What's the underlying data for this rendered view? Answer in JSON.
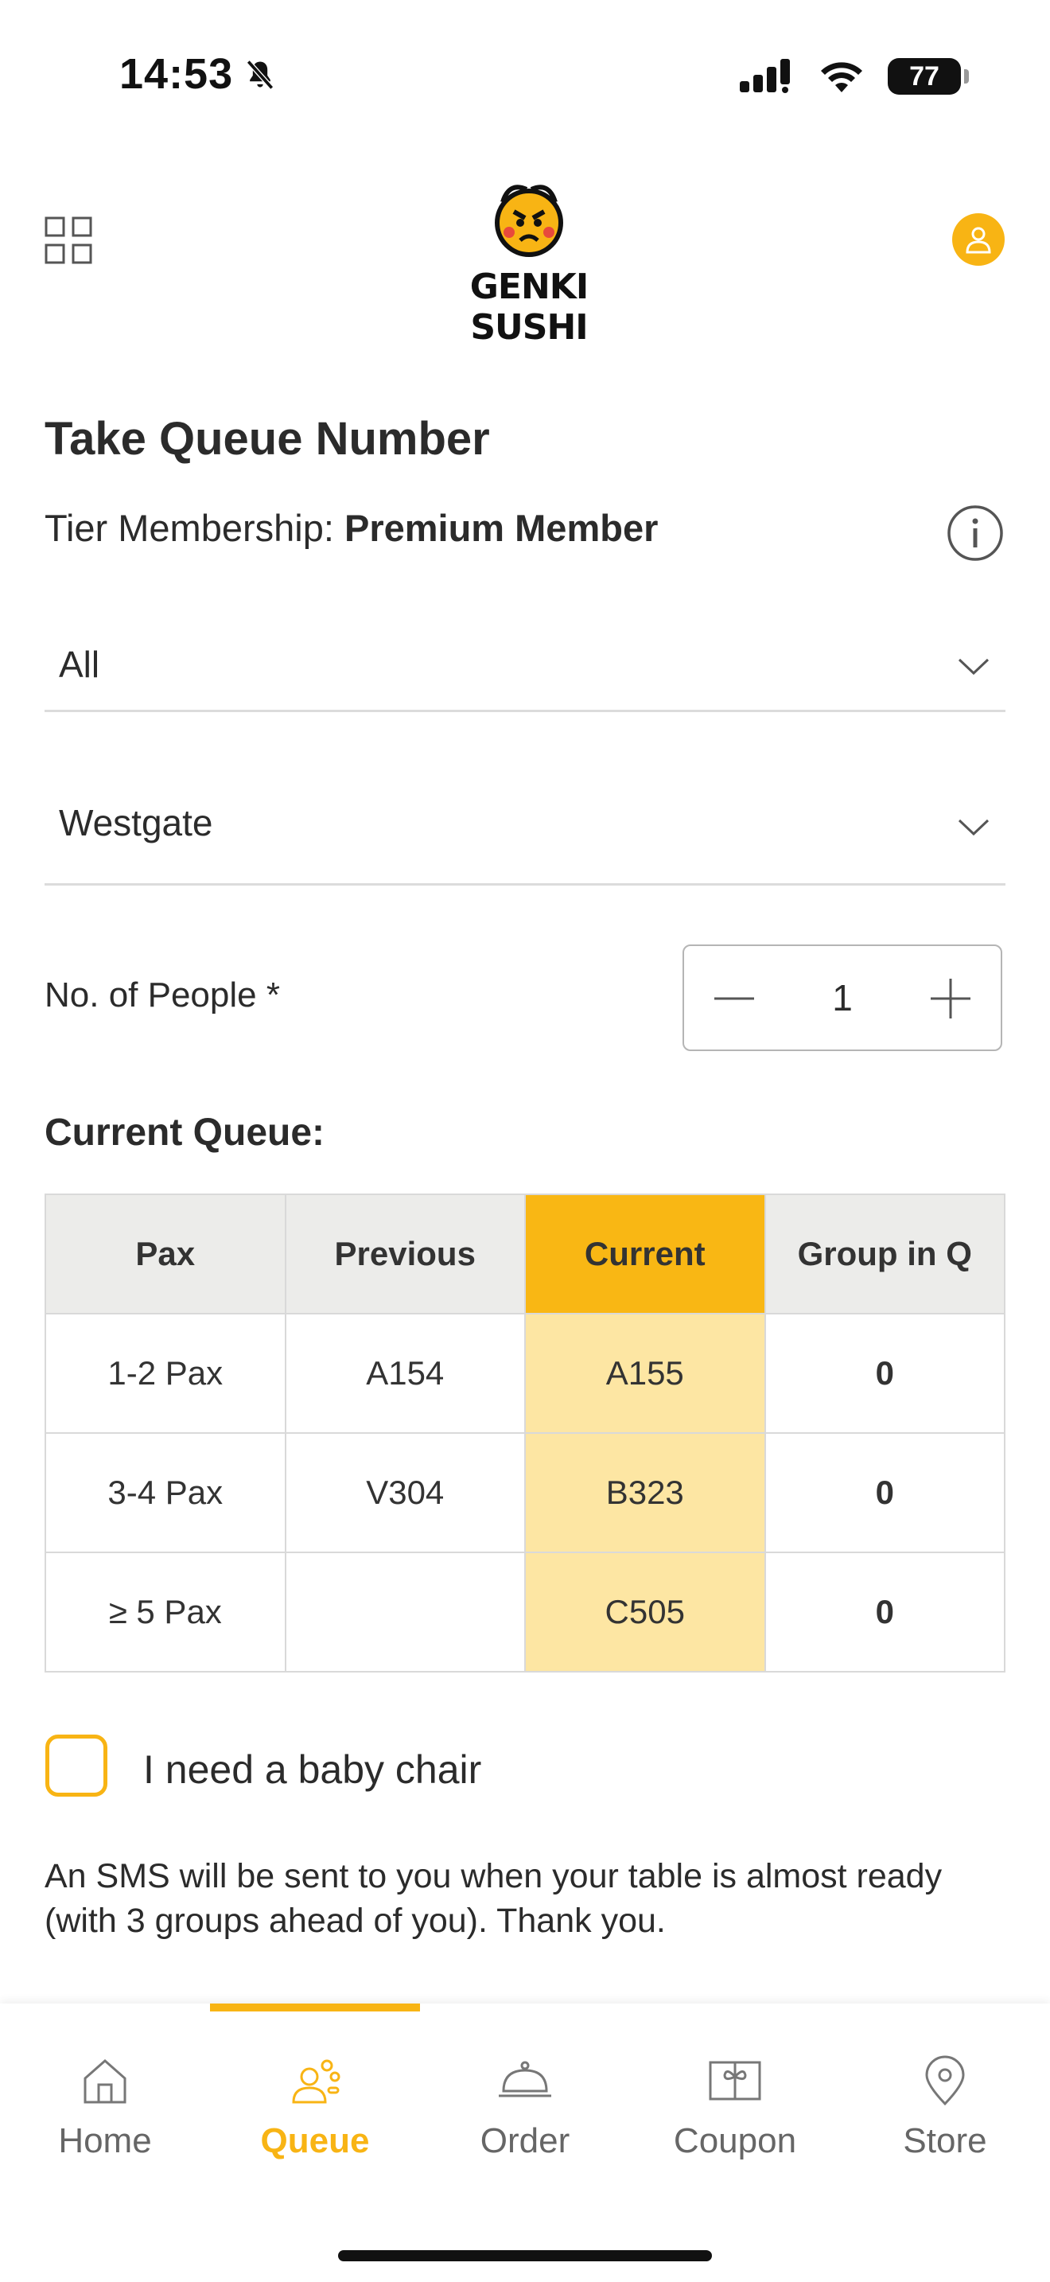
{
  "status_bar": {
    "time": "14:53",
    "battery": "77"
  },
  "header": {
    "brand": "GENKI SUSHI"
  },
  "page_title": "Take Queue Number",
  "tier": {
    "label": "Tier Membership:",
    "value": "Premium Member"
  },
  "filters": {
    "category": "All",
    "store": "Westgate"
  },
  "people": {
    "label": "No. of People  *",
    "value": "1"
  },
  "queue": {
    "title": "Current Queue:",
    "headers": [
      "Pax",
      "Previous",
      "Current",
      "Group in Q"
    ],
    "rows": [
      [
        "1-2 Pax",
        "A154",
        "A155",
        "0"
      ],
      [
        "3-4 Pax",
        "V304",
        "B323",
        "0"
      ],
      [
        "≥ 5 Pax",
        "",
        "C505",
        "0"
      ]
    ]
  },
  "baby_chair": {
    "label": "I need a baby chair",
    "checked": false
  },
  "sms_note": "An SMS will be sent to you when your table is almost ready (with 3 groups ahead of you). Thank you.",
  "nav": {
    "items": [
      {
        "label": "Home",
        "icon": "home-icon"
      },
      {
        "label": "Queue",
        "icon": "queue-icon"
      },
      {
        "label": "Order",
        "icon": "order-icon"
      },
      {
        "label": "Coupon",
        "icon": "coupon-icon"
      },
      {
        "label": "Store",
        "icon": "store-icon"
      }
    ],
    "active": "Queue"
  },
  "colors": {
    "accent": "#f8b414",
    "current_cell": "#fde6a3",
    "header_cell": "#ececea"
  }
}
